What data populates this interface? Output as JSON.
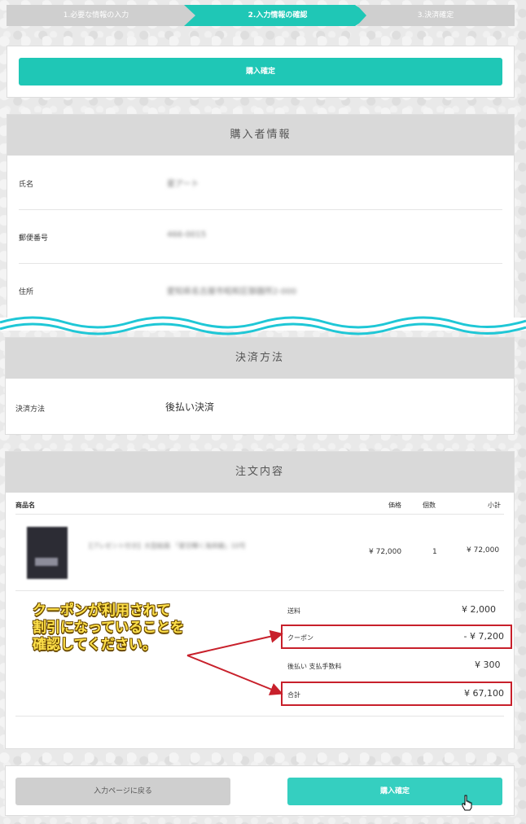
{
  "steps": [
    "1.必要な情報の入力",
    "2.入力情報の確認",
    "3.決済確定"
  ],
  "top_confirm_button": "購入確定",
  "buyer_section": {
    "title": "購入者情報",
    "rows": [
      {
        "label": "氏名",
        "value": "星アート"
      },
      {
        "label": "郵便番号",
        "value": "466-0015"
      },
      {
        "label": "住所",
        "value": "愛知県名古屋市昭和区御器所2-000"
      }
    ]
  },
  "payment_section": {
    "title": "決済方法",
    "label": "決済方法",
    "value": "後払い決済"
  },
  "order_section": {
    "title": "注文内容",
    "headers": {
      "name": "商品名",
      "price": "価格",
      "qty": "個数",
      "subtotal": "小計"
    },
    "item": {
      "name": "【プレゼント付き】大型絵画 「星空輝く海岸線」10号",
      "price": "¥ 72,000",
      "qty": "1",
      "subtotal": "¥ 72,000"
    },
    "summary": [
      {
        "label": "送料",
        "value": "¥ 2,000"
      },
      {
        "label": "クーポン",
        "value": "- ¥ 7,200"
      },
      {
        "label": "後払い 支払手数料",
        "value": "¥ 300"
      },
      {
        "label": "合計",
        "value": "¥ 67,100"
      }
    ]
  },
  "annotation": {
    "lines": [
      "クーポンが利用されて",
      "割引になっていることを",
      "確認してください。"
    ],
    "color": "#c8202b"
  },
  "bottom": {
    "back_button": "入力ページに戻る",
    "confirm_button": "購入確定"
  },
  "colors": {
    "accent": "#1fc7b6",
    "highlight": "#c8202b"
  }
}
